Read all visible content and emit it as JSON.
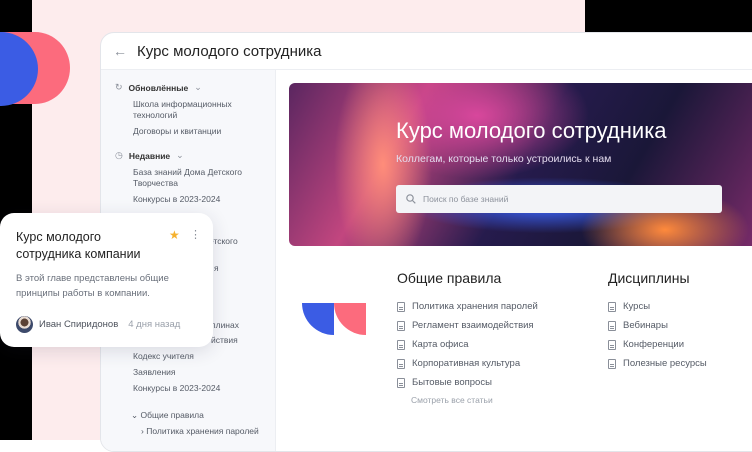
{
  "window": {
    "title": "Курс молодого сотрудника",
    "back_icon": "arrow-left-icon"
  },
  "sidebar": {
    "updated": {
      "label": "Обновлённые",
      "items": [
        "Школа информационных технологий",
        "Договоры и квитанции"
      ]
    },
    "recent": {
      "label": "Недавние",
      "items": [
        "База знаний Дома Детского Творчества",
        "Конкурсы в 2023-2024"
      ]
    },
    "hidden_items": [
      "етского",
      "я",
      "плинах",
      "йствия"
    ],
    "more_items": [
      "Кодекс учителя",
      "Заявления",
      "Конкурсы в 2023-2024"
    ],
    "tree": {
      "folder": "Общие правила",
      "child": "Политика хранения паролей"
    }
  },
  "hero": {
    "title": "Курс молодого сотрудника",
    "subtitle": "Коллегам, которые только устроились к нам",
    "search_placeholder": "Поиск по базе знаний"
  },
  "sections": [
    {
      "title": "Общие правила",
      "items": [
        "Политика хранения паролей",
        "Регламент взаимодействия",
        "Карта офиса",
        "Корпоративная культура",
        "Бытовые вопросы"
      ],
      "more": "Смотреть все статьи"
    },
    {
      "title": "Дисциплины",
      "items": [
        "Курсы",
        "Вебинары",
        "Конференции",
        "Полезные ресурсы"
      ]
    }
  ],
  "card": {
    "title": "Курс молодого сотрудника компании",
    "description": "В этой главе представлены общие принципы работы в компании.",
    "author": "Иван Спиридонов",
    "time": "4 дня назад"
  },
  "colors": {
    "blue": "#3b5ce4",
    "pink": "#fc6b7d",
    "star": "#f5b12e"
  }
}
